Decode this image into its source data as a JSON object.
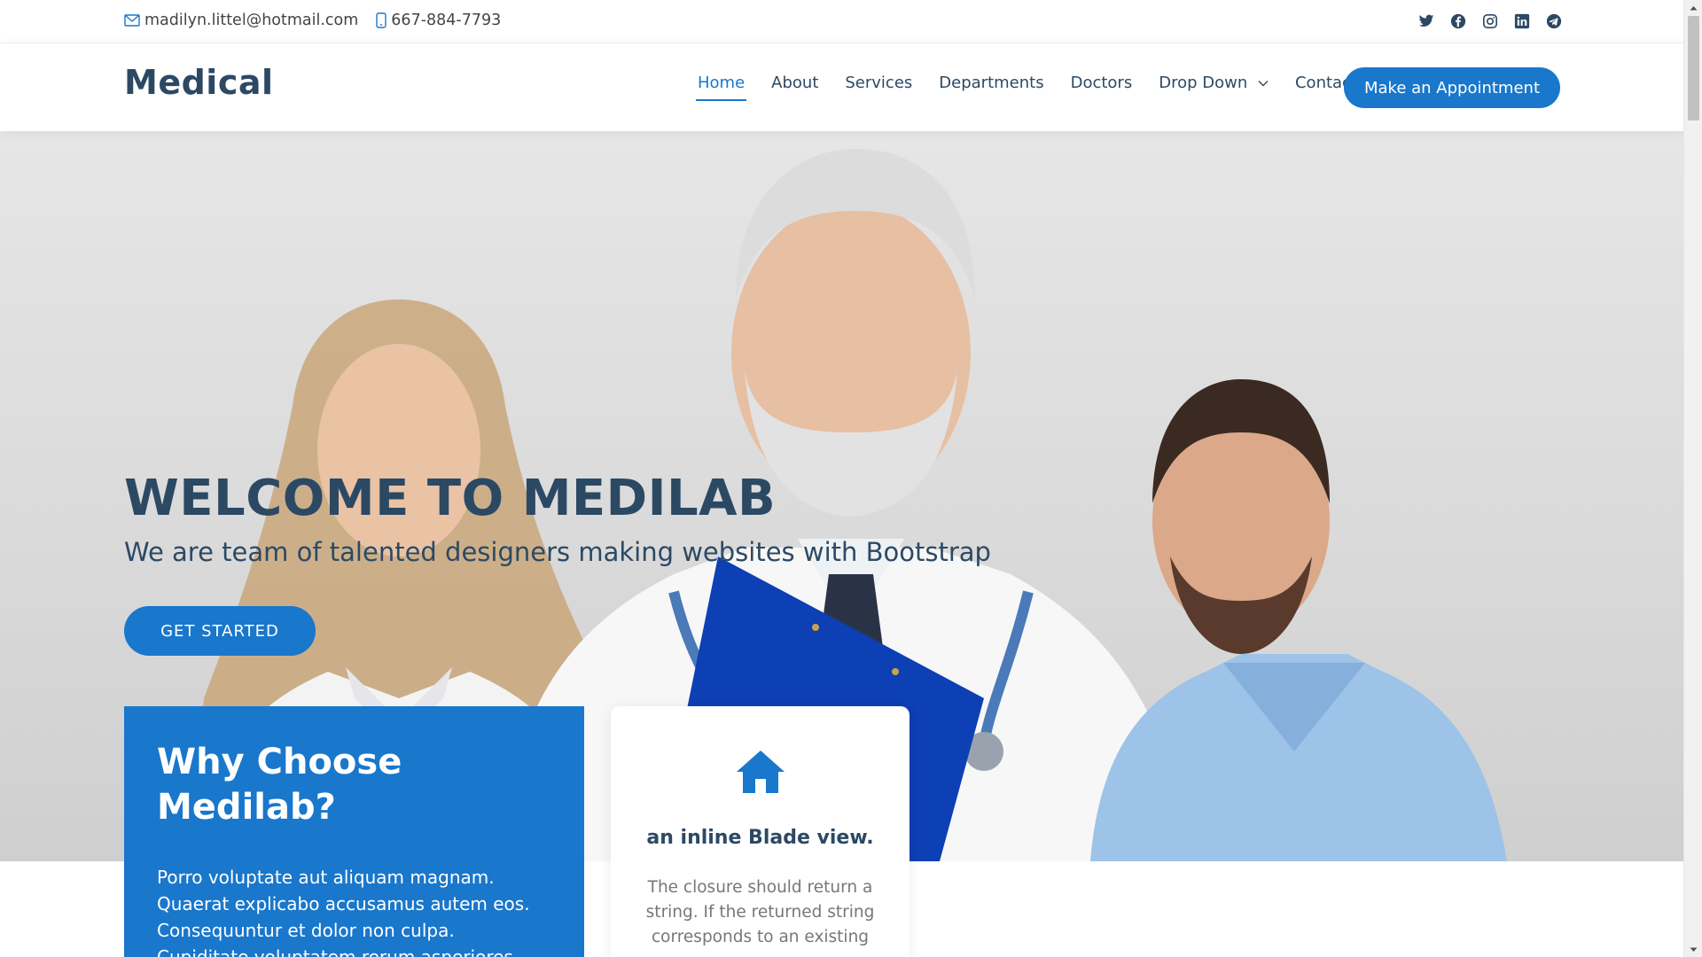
{
  "topbar": {
    "email": "madilyn.littel@hotmail.com",
    "phone": "667-884-7793",
    "social": [
      {
        "icon": "twitter-icon"
      },
      {
        "icon": "facebook-icon"
      },
      {
        "icon": "instagram-icon"
      },
      {
        "icon": "linkedin-icon"
      },
      {
        "icon": "telegram-icon"
      }
    ]
  },
  "header": {
    "logo": "Medical",
    "nav": {
      "home": "Home",
      "about": "About",
      "services": "Services",
      "departments": "Departments",
      "doctors": "Doctors",
      "dropdown": "Drop Down",
      "contact": "Contact"
    },
    "appointment_button": "Make an Appointment"
  },
  "hero": {
    "title": "WELCOME TO MEDILAB",
    "subtitle": "We are team of talented designers making websites with Bootstrap",
    "cta": "GET STARTED"
  },
  "why_box": {
    "title_line1": "Why Choose",
    "title_line2": "Medilab?",
    "text": "Porro voluptate aut aliquam magnam. Quaerat explicabo accusamus autem eos. Consequuntur et dolor non culpa. Cupiditate voluptatem rerum asperiores eaque."
  },
  "feature_card": {
    "icon": "home-icon",
    "title": "an inline Blade view.",
    "text": "The closure should return a string. If the returned string corresponds to an existing"
  },
  "colors": {
    "primary": "#1977cc",
    "heading": "#2c4964",
    "text_muted": "#777777"
  }
}
